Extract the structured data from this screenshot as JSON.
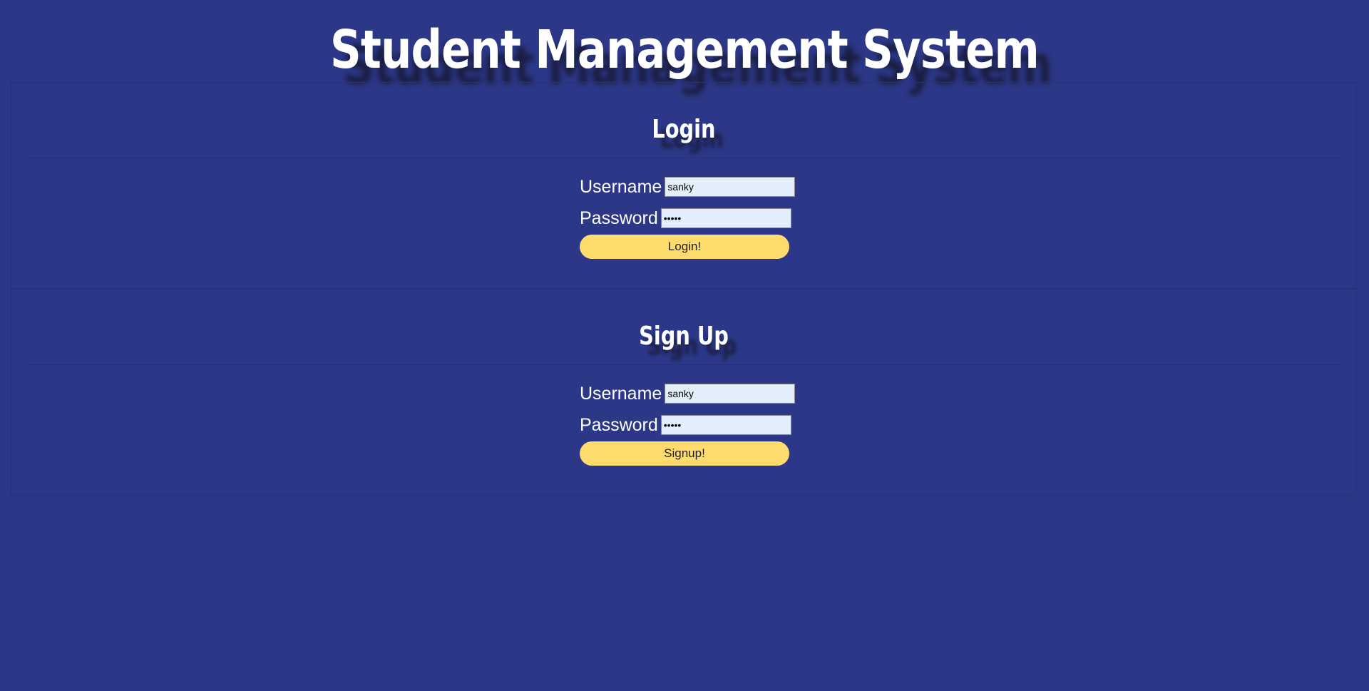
{
  "app": {
    "title": "Student Management System"
  },
  "login": {
    "title": "Login",
    "username_label": "Username",
    "username_value": "sanky",
    "password_label": "Password",
    "password_value": "•••••",
    "button_label": "Login!"
  },
  "signup": {
    "title": "Sign Up",
    "username_label": "Username",
    "username_value": "sanky",
    "password_label": "Password",
    "password_value": "•••••",
    "button_label": "Signup!"
  },
  "colors": {
    "background": "#2c3887",
    "button": "#fddb6d",
    "input_background": "#e3eefc"
  }
}
